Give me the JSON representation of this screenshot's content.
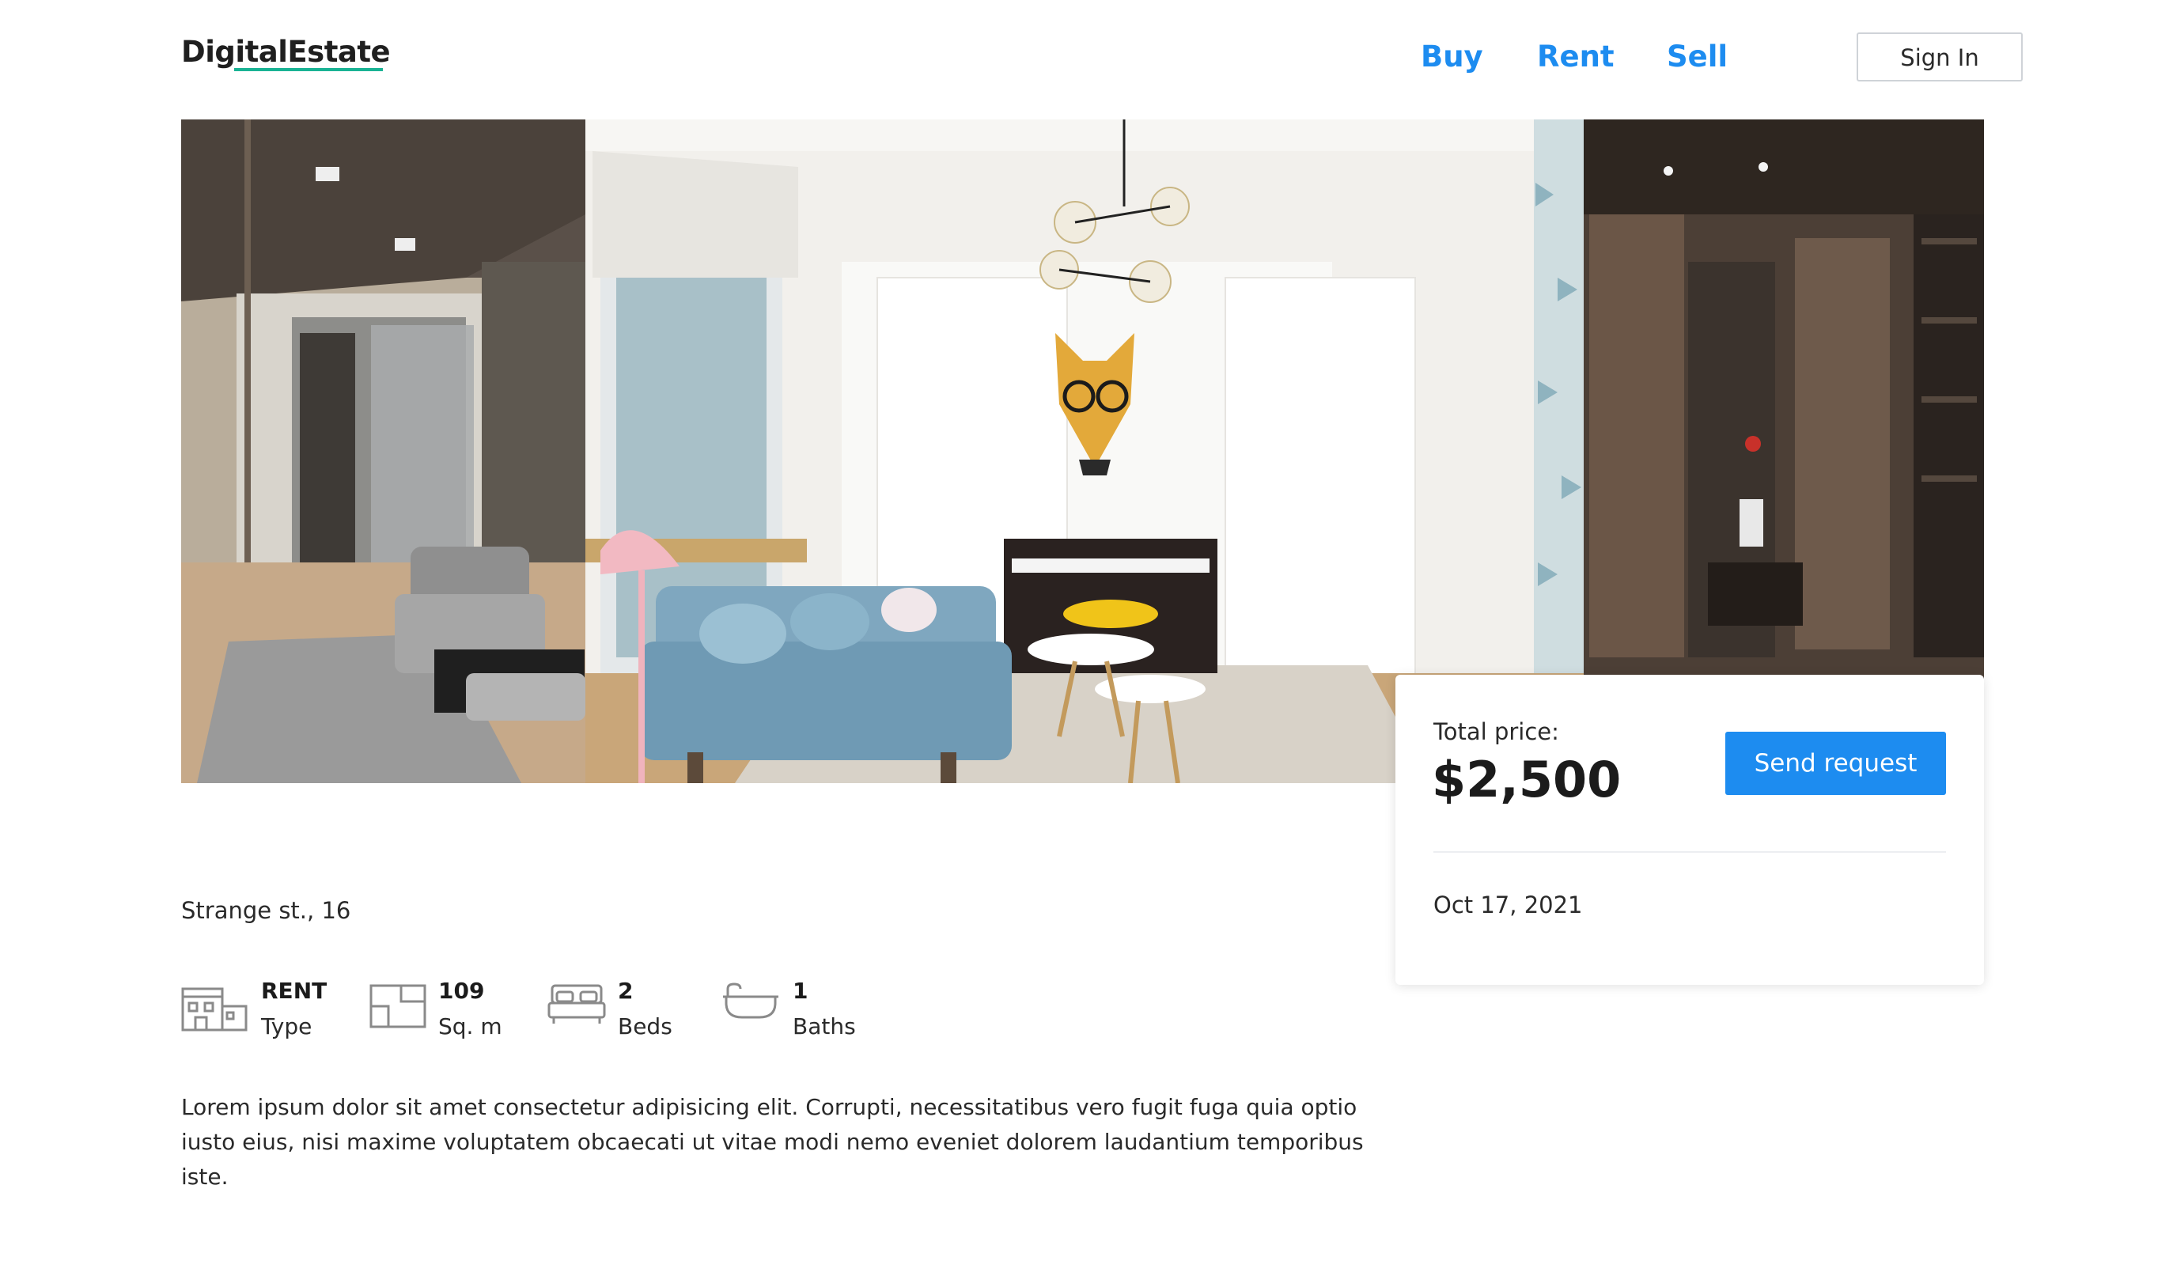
{
  "header": {
    "logo": "DigitalEstate",
    "nav": [
      {
        "label": "Buy"
      },
      {
        "label": "Rent"
      },
      {
        "label": "Sell"
      }
    ],
    "sign_in": "Sign In",
    "brand_color": "#1d8cf0",
    "accent_color": "#19b394"
  },
  "listing": {
    "address": "Strange st., 16",
    "features": [
      {
        "icon": "house-icon",
        "value": "RENT",
        "label": "Type"
      },
      {
        "icon": "floor-plan-icon",
        "value": "109",
        "label": "Sq. m"
      },
      {
        "icon": "bed-icon",
        "value": "2",
        "label": "Beds"
      },
      {
        "icon": "bathtub-icon",
        "value": "1",
        "label": "Baths"
      }
    ],
    "description": "Lorem ipsum dolor sit amet consectetur adipisicing elit. Corrupti, necessitatibus vero fugit fuga quia optio iusto eius, nisi maxime voluptatem obcaecati ut vitae modi nemo eveniet dolorem laudantium temporibus iste."
  },
  "price_card": {
    "label": "Total price:",
    "price": "$2,500",
    "button": "Send request",
    "date": "Oct 17, 2021"
  }
}
